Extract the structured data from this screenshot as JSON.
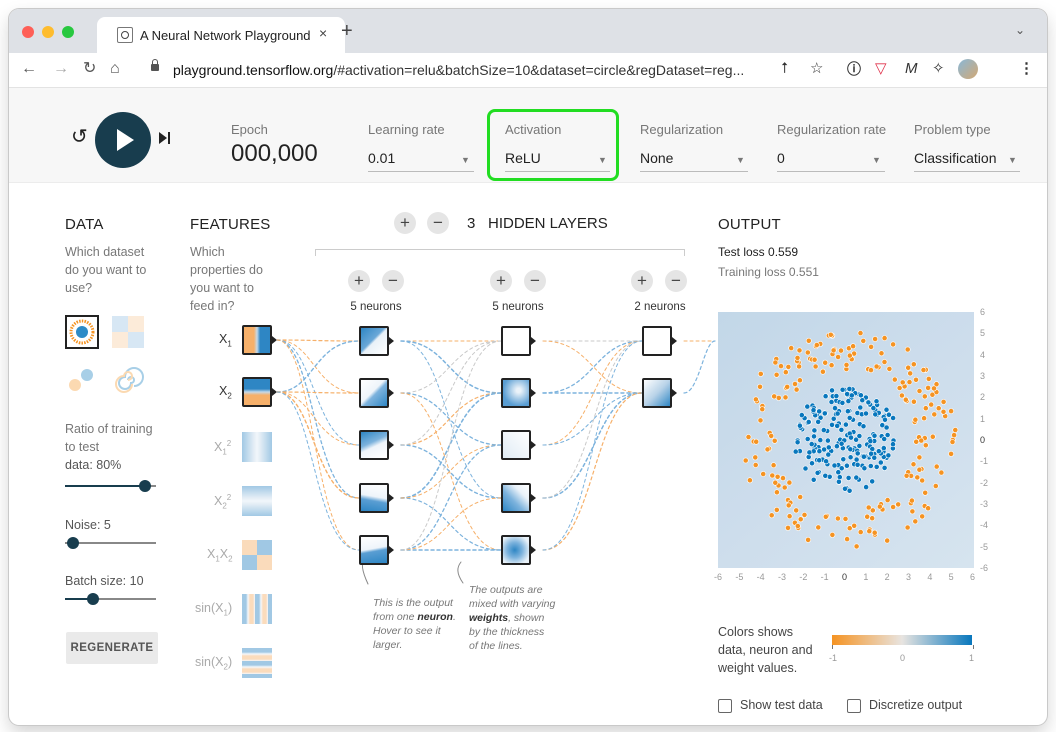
{
  "browser": {
    "tab_title": "A Neural Network Playground",
    "tab_close": "×",
    "new_tab": "+",
    "url_domain": "playground.tensorflow.org",
    "url_path": "/#activation=relu&batchSize=10&dataset=circle&regDataset=reg...",
    "icons": [
      "back-icon",
      "forward-icon",
      "reload-icon",
      "home-icon",
      "lock-icon",
      "share-icon",
      "star-icon",
      "info-icon",
      "pocket-icon",
      "m-extension-icon",
      "puzzle-icon",
      "profile-avatar",
      "kebab-menu-icon"
    ]
  },
  "header": {
    "epoch_label": "Epoch",
    "epoch_value": "000,000",
    "learning_rate": {
      "label": "Learning rate",
      "value": "0.01"
    },
    "activation": {
      "label": "Activation",
      "value": "ReLU"
    },
    "regularization": {
      "label": "Regularization",
      "value": "None"
    },
    "regularization_rate": {
      "label": "Regularization rate",
      "value": "0"
    },
    "problem_type": {
      "label": "Problem type",
      "value": "Classification"
    },
    "highlight_color": "#22dd22"
  },
  "data_panel": {
    "title": "DATA",
    "question": [
      "Which dataset",
      "do you want to",
      "use?"
    ],
    "ratio_label": [
      "Ratio of training",
      "to test"
    ],
    "ratio_value_label": "data:  80%",
    "ratio": 0.8,
    "noise_label": "Noise:  5",
    "noise": 5,
    "batch_label": "Batch size:  10",
    "batch": 10,
    "regenerate": "REGENERATE"
  },
  "features": {
    "title": "FEATURES",
    "question": [
      "Which",
      "properties do",
      "you want to",
      "feed in?"
    ],
    "items": [
      "X",
      "X",
      "X",
      "X",
      "XX",
      "sin(X",
      "sin(X"
    ]
  },
  "network": {
    "hidden_layers_count": "3",
    "hidden_layers_label": "HIDDEN LAYERS",
    "layers": [
      {
        "neurons": "5 neurons"
      },
      {
        "neurons": "5 neurons"
      },
      {
        "neurons": "2 neurons"
      }
    ],
    "annotation_left": [
      "This is the output",
      "from one neuron.",
      "Hover to see it",
      "larger."
    ],
    "annotation_right": [
      "The outputs are",
      "mixed with varying",
      "weights, shown",
      "by the thickness",
      "of the lines."
    ]
  },
  "output": {
    "title": "OUTPUT",
    "test_loss": "Test loss 0.559",
    "training_loss": "Training loss 0.551",
    "x_ticks": [
      "-6",
      "-5",
      "-4",
      "-3",
      "-2",
      "-1",
      "0",
      "1",
      "2",
      "3",
      "4",
      "5",
      "6"
    ],
    "y_ticks": [
      "6",
      "5",
      "4",
      "3",
      "2",
      "1",
      "0",
      "-1",
      "-2",
      "-3",
      "-4",
      "-5",
      "-6"
    ],
    "legend_text": [
      "Colors shows",
      "data, neuron and",
      "weight values."
    ],
    "legend_ticks": [
      "-1",
      "0",
      "1"
    ],
    "show_test_data": "Show test data",
    "discretize_output": "Discretize output",
    "colors": {
      "orange": "#f59322",
      "blue": "#0877bd",
      "background": "#c7dbea"
    }
  }
}
